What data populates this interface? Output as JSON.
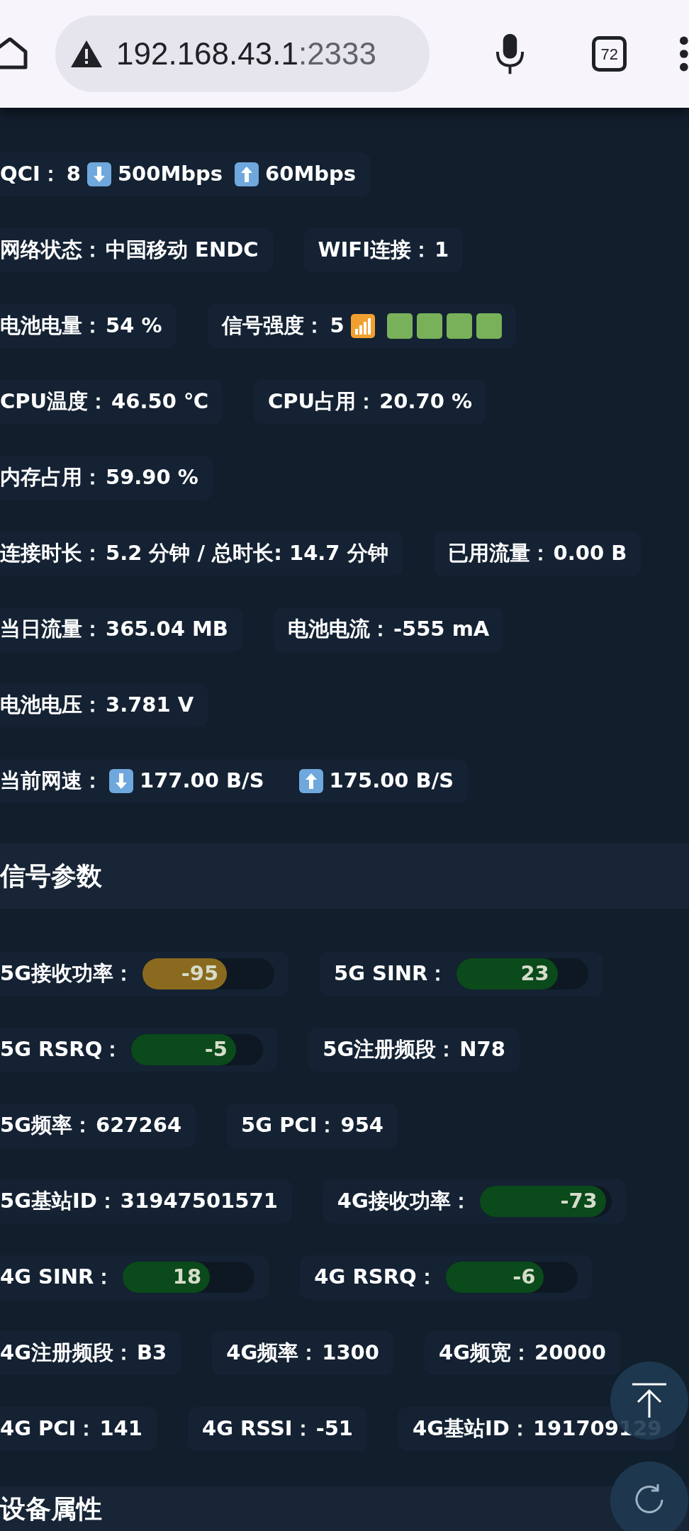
{
  "browser": {
    "url_host": "192.168.43.1",
    "url_port": ":2333",
    "tab_count": "72"
  },
  "status_rows": [
    [
      {
        "kind": "rate",
        "label": "QCI：",
        "value": "8",
        "down": "500Mbps",
        "up": "60Mbps"
      }
    ],
    [
      {
        "kind": "text",
        "label": "网络状态：",
        "value": "中国移动 ENDC"
      },
      {
        "kind": "text",
        "label": "WIFI连接：",
        "value": "1"
      }
    ],
    [
      {
        "kind": "text",
        "label": "电池电量：",
        "value": "54 %"
      },
      {
        "kind": "signal",
        "label": "信号强度：",
        "value": "5",
        "stars": 4
      }
    ],
    [
      {
        "kind": "text",
        "label": "CPU温度：",
        "value": "46.50 ℃"
      },
      {
        "kind": "text",
        "label": "CPU占用：",
        "value": "20.70 %"
      }
    ],
    [
      {
        "kind": "text",
        "label": "内存占用：",
        "value": "59.90 %"
      }
    ],
    [
      {
        "kind": "text",
        "label": "连接时长：",
        "value": "5.2 分钟 / 总时长: 14.7 分钟"
      },
      {
        "kind": "text",
        "label": "已用流量：",
        "value": "0.00 B"
      }
    ],
    [
      {
        "kind": "text",
        "label": "当日流量：",
        "value": "365.04 MB"
      },
      {
        "kind": "text",
        "label": "电池电流：",
        "value": "-555 mA"
      }
    ],
    [
      {
        "kind": "text",
        "label": "电池电压：",
        "value": "3.781 V"
      }
    ],
    [
      {
        "kind": "rate",
        "label": "当前网速：",
        "down": "177.00 B/S",
        "up": "175.00 B/S"
      }
    ]
  ],
  "signal_section": {
    "title": "信号参数",
    "rows": [
      [
        {
          "kind": "bar",
          "label": "5G接收功率：",
          "value": "-95",
          "level": 0.67,
          "color": "#8a6a1e"
        },
        {
          "kind": "bar",
          "label": "5G SINR：",
          "value": "23",
          "level": 0.8,
          "color": "#0b4a1a"
        }
      ],
      [
        {
          "kind": "bar",
          "label": "5G RSRQ：",
          "value": "-5",
          "level": 0.83,
          "color": "#0b4a1a"
        },
        {
          "kind": "text",
          "label": "5G注册频段：",
          "value": "N78"
        }
      ],
      [
        {
          "kind": "text",
          "label": "5G频率：",
          "value": "627264"
        },
        {
          "kind": "text",
          "label": "5G PCI：",
          "value": "954"
        }
      ],
      [
        {
          "kind": "text",
          "label": "5G基站ID：",
          "value": "31947501571"
        },
        {
          "kind": "bar",
          "label": "4G接收功率：",
          "value": "-73",
          "level": 1,
          "color": "#0b4a1a"
        }
      ],
      [
        {
          "kind": "bar",
          "label": "4G SINR：",
          "value": "18",
          "level": 0.69,
          "color": "#0b4a1a"
        },
        {
          "kind": "bar",
          "label": "4G RSRQ：",
          "value": "-6",
          "level": 0.78,
          "color": "#0b4a1a"
        }
      ],
      [
        {
          "kind": "text",
          "label": "4G注册频段：",
          "value": "B3"
        },
        {
          "kind": "text",
          "label": "4G频率：",
          "value": "1300"
        },
        {
          "kind": "text",
          "label": "4G频宽：",
          "value": "20000"
        }
      ],
      [
        {
          "kind": "text",
          "label": "4G PCI：",
          "value": "141"
        },
        {
          "kind": "text",
          "label": "4G RSSI：",
          "value": "-51"
        },
        {
          "kind": "text",
          "label": "4G基站ID：",
          "value": "191709129"
        }
      ]
    ]
  },
  "next_section": {
    "title": "设备属性"
  }
}
